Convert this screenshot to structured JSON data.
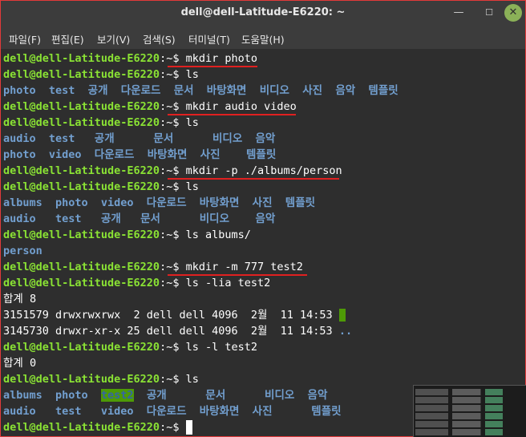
{
  "window": {
    "title": "dell@dell-Latitude-E6220: ~",
    "min_icon": "minimize-icon",
    "max_icon": "maximize-icon",
    "close_icon": "close-icon"
  },
  "menu": [
    "파일(F)",
    "편집(E)",
    "보기(V)",
    "검색(S)",
    "터미널(T)",
    "도움말(H)"
  ],
  "prompt": "dell@dell-Latitude-E6220",
  "prompt_suffix": ":~$ ",
  "lines": {
    "l1": "mkdir photo",
    "l2": "ls",
    "l3": "photo  test  공개  다운로드  문서  바탕화면  비디오  사진  음악  템플릿",
    "l4": "mkdir audio video",
    "l5": "ls",
    "l6": "audio  test   공개      문서      비디오  음악",
    "l7": "photo  video  다운로드  바탕화면  사진    템플릿",
    "l8": "mkdir -p ./albums/person",
    "l9": "ls",
    "l10": "albums  photo  video  다운로드  바탕화면  사진  템플릿",
    "l11": "audio   test   공개   문서      비디오    음악",
    "l12": "ls albums/",
    "l13": "person",
    "l14": "mkdir -m 777 test2",
    "l15": "ls -lia test2",
    "l16": "합계 8",
    "l17": "3151579 drwxrwxrwx  2 dell dell 4096  2월  11 14:53 ",
    "l17_dir": ".",
    "l18": "3145730 drwxr-xr-x 25 dell dell 4096  2월  11 14:53 ",
    "l18_dir": "..",
    "l19": "ls -l test2",
    "l20": "합계 0",
    "l21": "ls",
    "l22_a": "albums  photo  ",
    "l22_hl": "test2",
    "l22_b": "  공개      문서      비디오  음악",
    "l23": "audio   test   video  다운로드  바탕화면  사진      템플릿"
  },
  "colors": {
    "prompt": "#8ae234",
    "directory": "#729fcf",
    "highlight_bg": "#4e9a06",
    "annotation": "#e02020"
  }
}
